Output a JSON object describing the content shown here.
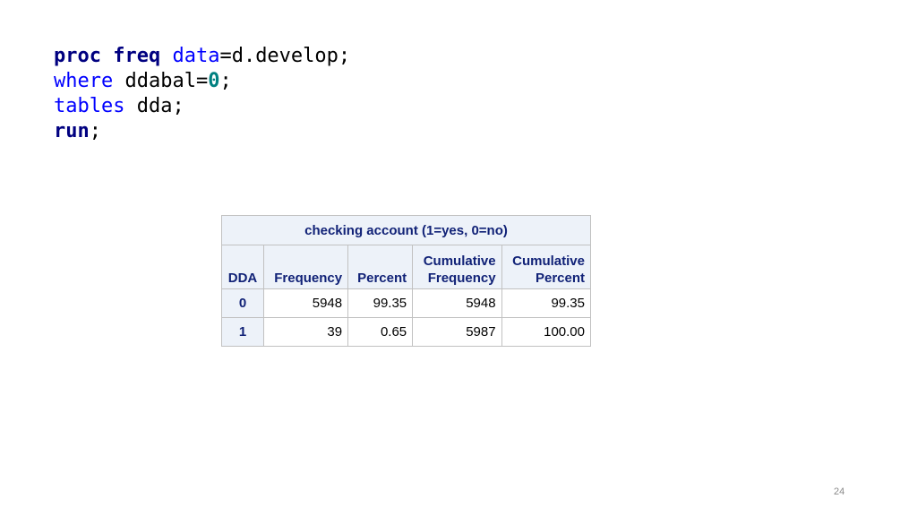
{
  "code": {
    "line1": {
      "kw1": "proc freq",
      "kw2": "data",
      "rest": "=d.develop;"
    },
    "line2": {
      "kw": "where",
      "rest": " ddabal=",
      "num": "0",
      "end": ";"
    },
    "line3": {
      "kw": "tables",
      "rest": " dda;"
    },
    "line4": {
      "kw": "run",
      "rest": ";"
    }
  },
  "table": {
    "title": "checking account (1=yes, 0=no)",
    "headers": {
      "dda": "DDA",
      "frequency": "Frequency",
      "percent": "Percent",
      "cum_freq_1": "Cumulative",
      "cum_freq_2": "Frequency",
      "cum_pct_1": "Cumulative",
      "cum_pct_2": "Percent"
    },
    "rows": [
      {
        "dda": "0",
        "frequency": "5948",
        "percent": "99.35",
        "cum_frequency": "5948",
        "cum_percent": "99.35"
      },
      {
        "dda": "1",
        "frequency": "39",
        "percent": "0.65",
        "cum_frequency": "5987",
        "cum_percent": "100.00"
      }
    ]
  },
  "slide": {
    "page_number": "24"
  },
  "colors": {
    "keyword_navy": "#000080",
    "keyword_blue": "#0000ff",
    "number_teal": "#008080",
    "table_header_bg": "#edf2f9",
    "table_header_text": "#112277"
  }
}
